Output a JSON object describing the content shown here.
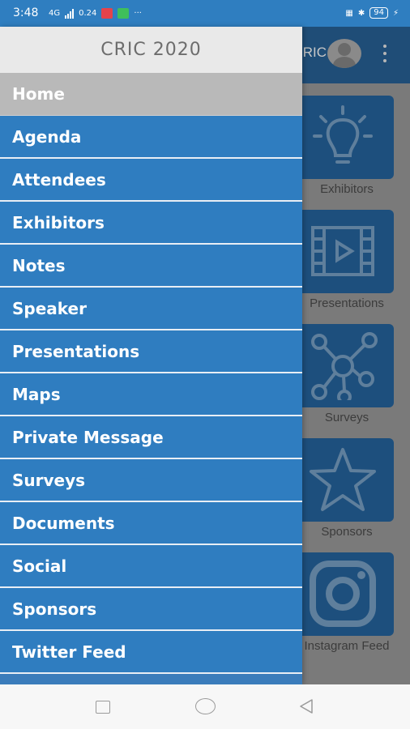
{
  "status_bar": {
    "time": "3:48",
    "network_label": "4G",
    "speed_label": "0.24",
    "battery": "94",
    "dots": "···"
  },
  "background_app": {
    "header_title": "CRIC",
    "tiles": [
      {
        "label": "Exhibitors",
        "icon": "lightbulb-icon"
      },
      {
        "label": "Presentations",
        "icon": "film-play-icon"
      },
      {
        "label": "Surveys",
        "icon": "network-nodes-icon"
      },
      {
        "label": "Sponsors",
        "icon": "star-icon"
      },
      {
        "label": "Instagram Feed",
        "icon": "instagram-icon"
      }
    ]
  },
  "drawer": {
    "title": "CRIC 2020",
    "items": [
      {
        "label": "Home"
      },
      {
        "label": "Agenda"
      },
      {
        "label": "Attendees"
      },
      {
        "label": "Exhibitors"
      },
      {
        "label": "Notes"
      },
      {
        "label": "Speaker"
      },
      {
        "label": "Presentations"
      },
      {
        "label": "Maps"
      },
      {
        "label": "Private Message"
      },
      {
        "label": "Surveys"
      },
      {
        "label": "Documents"
      },
      {
        "label": "Social"
      },
      {
        "label": "Sponsors"
      },
      {
        "label": "Twitter Feed"
      }
    ]
  },
  "colors": {
    "drawer_item_bg": "#2f7dc0",
    "active_item_bg": "#b9b9b9",
    "status_bar_bg": "#2f7ec0",
    "tile_bg": "#1d4f7d"
  }
}
